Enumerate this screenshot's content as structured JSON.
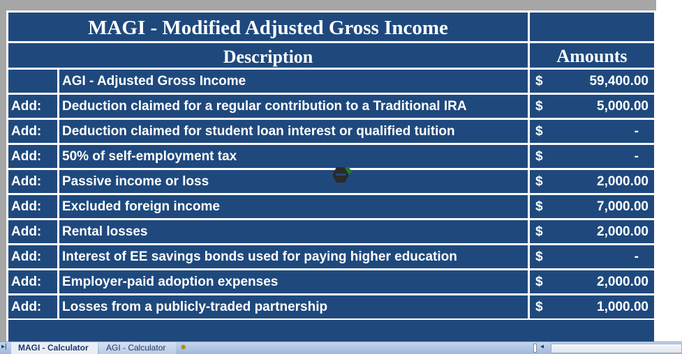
{
  "sheet": {
    "title": "MAGI - Modified Adjusted Gross Income",
    "headers": {
      "description": "Description",
      "amounts": "Amounts"
    },
    "currency_symbol": "$",
    "rows": [
      {
        "prefix": "",
        "description": "AGI - Adjusted Gross Income",
        "amount": "59,400.00"
      },
      {
        "prefix": "Add:",
        "description": "Deduction claimed for a regular contribution to a Traditional IRA",
        "amount": "5,000.00"
      },
      {
        "prefix": "Add:",
        "description": "Deduction claimed for student loan interest or qualified tuition",
        "amount": "-"
      },
      {
        "prefix": "Add:",
        "description": "50% of self-employment tax",
        "amount": "-"
      },
      {
        "prefix": "Add:",
        "description": "Passive income or loss",
        "amount": "2,000.00"
      },
      {
        "prefix": "Add:",
        "description": "Excluded foreign income",
        "amount": "7,000.00"
      },
      {
        "prefix": "Add:",
        "description": "Rental losses",
        "amount": "2,000.00"
      },
      {
        "prefix": "Add:",
        "description": "Interest of EE savings bonds used for paying higher education",
        "amount": "-"
      },
      {
        "prefix": "Add:",
        "description": "Employer-paid adoption expenses",
        "amount": "2,000.00"
      },
      {
        "prefix": "Add:",
        "description": "Losses from a publicly-traded partnership",
        "amount": "1,000.00"
      }
    ]
  },
  "tabs": [
    {
      "label": "MAGI - Calculator",
      "active": true
    },
    {
      "label": "AGI - Calculator",
      "active": false
    }
  ],
  "icons": {
    "tab_nav": "▸|",
    "new_sheet": "✹",
    "scroll_left": "◂"
  },
  "colors": {
    "cell_bg": "#1f497d",
    "grid": "#ffffff",
    "outside": "#a6a6a6"
  }
}
